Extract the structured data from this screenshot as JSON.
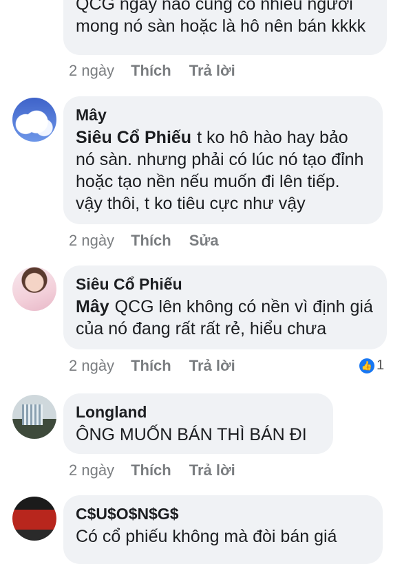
{
  "comments": [
    {
      "id": "c0",
      "text_lines": "QCG ngày nào cũng có nhiều người mong nó sàn hoặc là hô nên bán kkkk",
      "time": "2 ngày",
      "like_label": "Thích",
      "reply_label": "Trả lời"
    },
    {
      "id": "c1",
      "author": "Mây",
      "mention": "Siêu Cổ Phiếu",
      "text": "t ko hô hào hay bảo nó sàn. nhưng phải có lúc nó tạo đỉnh hoặc tạo nền nếu muốn đi lên tiếp. vậy thôi, t ko tiêu cực như vậy",
      "time": "2 ngày",
      "like_label": "Thích",
      "edit_label": "Sửa",
      "avatar_icon": "sky-clouds-avatar"
    },
    {
      "id": "c2",
      "author": "Siêu Cổ Phiếu",
      "mention": "Mây",
      "text": "QCG lên không có nền vì định giá của nó đang rất rất rẻ, hiểu chưa",
      "time": "2 ngày",
      "like_label": "Thích",
      "reply_label": "Trả lời",
      "reaction_count": "1",
      "reaction_icon": "thumbs-up-icon",
      "reaction_color": "#1877f2",
      "avatar_icon": "woman-portrait-avatar"
    },
    {
      "id": "c3",
      "author": "Longland",
      "text": "ÔNG MUỐN BÁN THÌ BÁN ĐI",
      "time": "2 ngày",
      "like_label": "Thích",
      "reply_label": "Trả lời",
      "avatar_icon": "building-avatar"
    },
    {
      "id": "c4",
      "author": "C$U$O$N$G$",
      "text": "Có cổ phiếu không mà đòi bán giá",
      "avatar_icon": "red-car-avatar"
    }
  ],
  "colors": {
    "bubble_bg": "#f0f2f5",
    "meta_text": "#7a7d80",
    "like_blue": "#1877f2"
  }
}
